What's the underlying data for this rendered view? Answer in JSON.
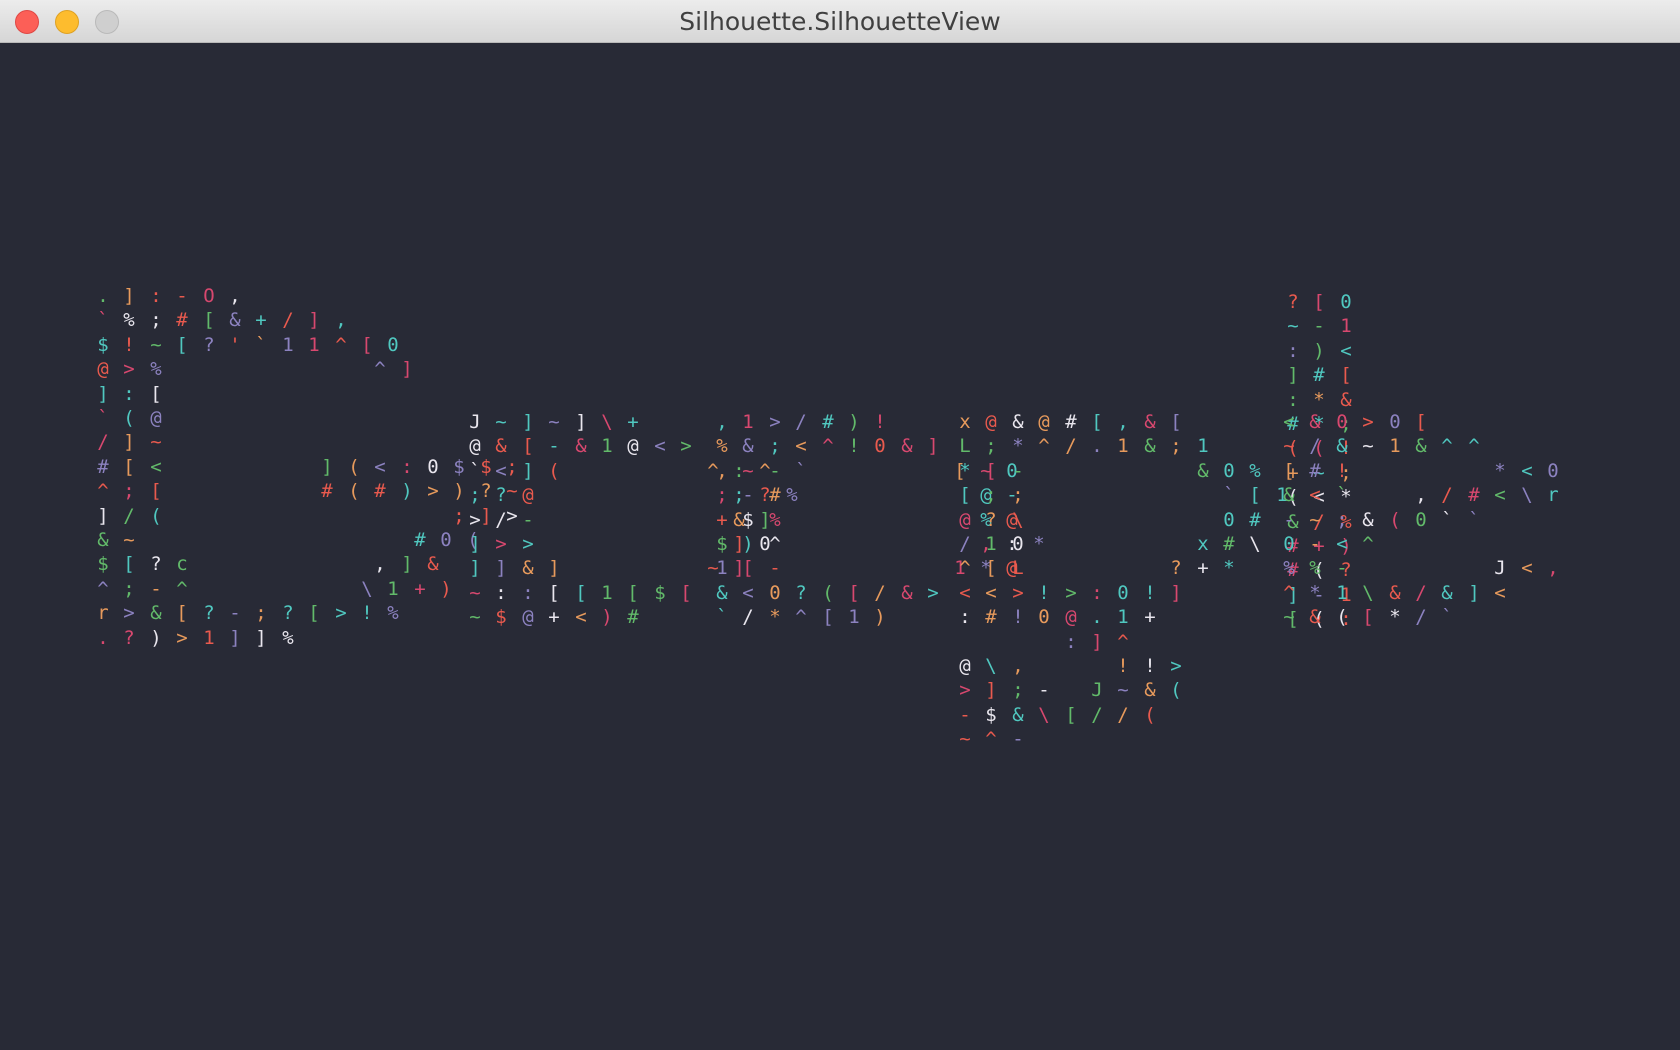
{
  "window": {
    "title": "Silhouette.SilhouetteView"
  },
  "palette": [
    "#50c8c0",
    "#e9e6ee",
    "#d8486f",
    "#e95a4e",
    "#8c82c0",
    "#62ba6a",
    "#e79a5c"
  ],
  "silhouette": {
    "text": "Google",
    "glyph_set": "%;#[&+/]$!~?^10@>:(<)\\-",
    "letters": [
      {
        "char": "G",
        "rows": [
          ". ] : - O ,",
          "` % ; # [ & + / ] ,",
          "$ ! ~ [ ? ' ` 1 1 ^ [ 0",
          "@ > %                ^ ]",
          "] : [",
          "` ( @",
          "/ ] ~",
          "# [ <            ] ( < : 0 $ $ ;",
          "^ ; [            # ( # ) > ) ? ~",
          "] / (                      ; ] >",
          "& ~                     # 0 (",
          "$ [ ? c              , ] &",
          "^ ; - ^             \\ 1 + )",
          "r > & [ ? - ; ? [ > ! %",
          ". ? ) > 1 ] ] %"
        ]
      },
      {
        "char": "o",
        "rows": [
          "J ~ ] ~ ] \\ +",
          "@ & [ - & 1 @ < >",
          "` < ] (           ^ : ^",
          "; ? @               ; ? %",
          "> / -               & ]",
          "] > >               ] 0",
          "] ] & ]           ~ ]",
          "~ : : [ [ 1 [ $ [",
          "~ $ @ + < ) #"
        ]
      },
      {
        "char": "o",
        "rows": [
          ", 1 > / # ) !",
          "% & ; < ^ ! 0 & ]",
          ", ~ - `           [ ~ 0",
          "; - #               @ -",
          "+ $ %               % @",
          "$ ) ^               , : *",
          "1 [ -             1 * @",
          "& < 0 ? ( [ / & >",
          "` / * ^ [ 1 )"
        ]
      },
      {
        "char": "g",
        "rows": [
          "x @ & @ # [ , & [",
          "L ; * ^ / . 1 & ; 1",
          "* [ -             & 0 %",
          "[ ; ;               ` [ 1",
          "@ ? \\               0 #",
          "/ 1 0             x # \\",
          "^ [ L           ? + *",
          "< < > ! > : 0 ! ]",
          ": # ! 0 @ . 1 +",
          "        : ] ^",
          "@ \\ ,       ! ! >",
          "> ] ; -   J ~ & (",
          "- $ & \\ [ / / (",
          "~ ^ -"
        ]
      },
      {
        "char": "l",
        "rows": [
          "? [ 0",
          "~ - 1",
          ": ) <",
          "] # [",
          ": * &",
          "# * ;",
          "( ( !",
          "+ ~ ;",
          "( < *",
          "& / %",
          "# + )",
          "# ( ?",
          "] - 1",
          "[ ( :"
        ]
      },
      {
        "char": "e",
        "rows": [
          "< & 0 > 0 [",
          "~ / & ~ 1 & ^ ^",
          "[ # !           * < 0",
          "& < `     , / # < \\ r",
          "- ~ ; & ( 0 ` `",
          "0 - < ^",
          "% % -           J < ,",
          "^ * 1 \\ & / & ] <",
          "~ & ( [ * / `"
        ]
      }
    ]
  }
}
